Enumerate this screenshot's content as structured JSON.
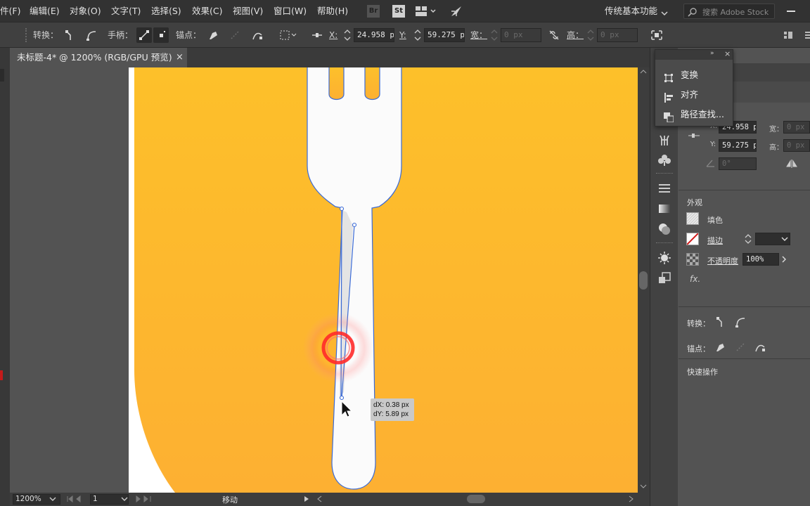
{
  "menubar": {
    "items": [
      "件(F)",
      "编辑(E)",
      "对象(O)",
      "文字(T)",
      "选择(S)",
      "效果(C)",
      "视图(V)",
      "窗口(W)",
      "帮助(H)"
    ],
    "bridge_label": "Br",
    "stock_label": "St",
    "workspace": "传统基本功能",
    "search_placeholder": "搜索 Adobe Stock"
  },
  "control_bar": {
    "convert_label": "转换：",
    "handles_label": "手柄：",
    "anchors_label": "锚点：",
    "x_label": "X:",
    "x_value": "24.958 p",
    "y_label": "Y:",
    "y_value": "59.275 p",
    "w_label": "宽：",
    "w_value": "0 px",
    "h_label": "高：",
    "h_value": "0 px"
  },
  "document": {
    "tab_title": "未标题-4* @ 1200% (RGB/GPU 预览)",
    "close_glyph": "×"
  },
  "canvas": {
    "tooltip_dx": "dX: 0.38 px",
    "tooltip_dy": "dY: 5.89 px",
    "orange_top": "#fdc02a",
    "orange_bottom": "#fdb032",
    "path_color": "#3a6ad6"
  },
  "statusbar": {
    "zoom": "1200%",
    "page": "1",
    "status": "移动"
  },
  "popup_menu": {
    "items": [
      "变换",
      "对齐",
      "路径查找..."
    ]
  },
  "properties": {
    "x_label": "X:",
    "x_value": "24.958 p",
    "y_label": "Y:",
    "y_value": "59.275 p",
    "w_label": "宽：",
    "w_value": "0 px",
    "h_label": "高：",
    "h_value": "0 px",
    "angle_value": "0°",
    "appearance_title": "外观",
    "fill_label": "填色",
    "stroke_label": "描边",
    "opacity_label": "不透明度",
    "opacity_value": "100%",
    "fx_label": "fx.",
    "convert_label": "转换：",
    "anchors_label": "锚点：",
    "quick_actions": "快速操作"
  }
}
